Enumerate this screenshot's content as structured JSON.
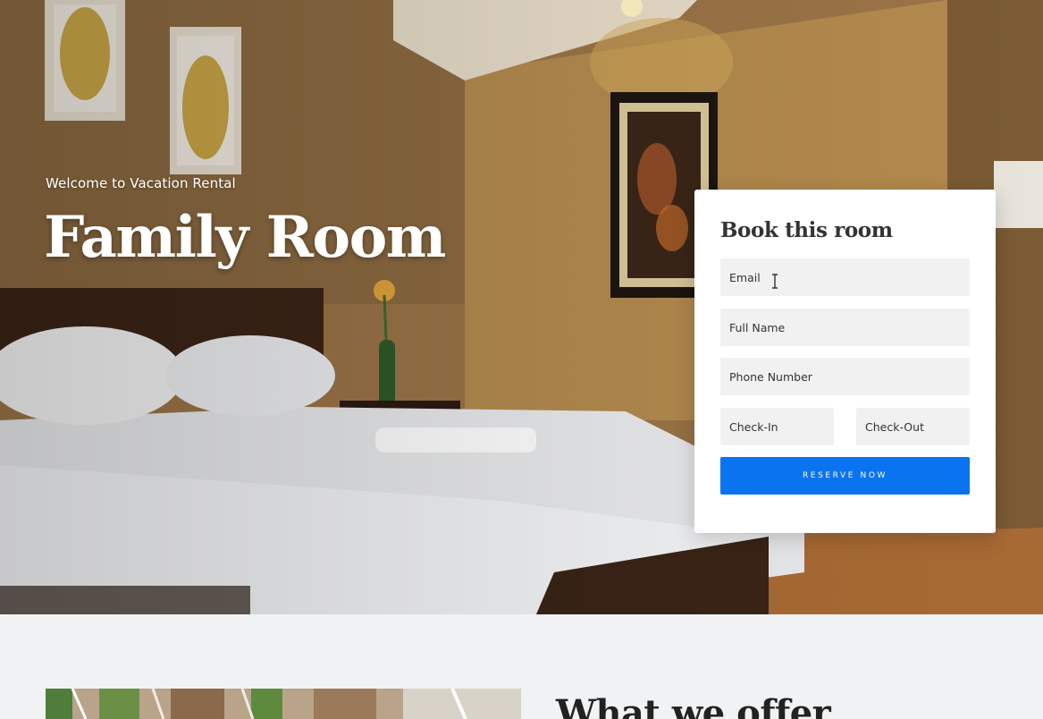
{
  "hero": {
    "eyebrow": "Welcome to Vacation Rental",
    "title": "Family Room"
  },
  "booking": {
    "title": "Book this room",
    "email_placeholder": "Email",
    "name_placeholder": "Full Name",
    "phone_placeholder": "Phone Number",
    "checkin_placeholder": "Check-In",
    "checkout_placeholder": "Check-Out",
    "reserve_label": "RESERVE NOW"
  },
  "offer": {
    "title": "What we offer"
  },
  "colors": {
    "accent": "#0a74f0",
    "field_bg": "#f1f1f2",
    "section_bg": "#f1f2f4"
  }
}
